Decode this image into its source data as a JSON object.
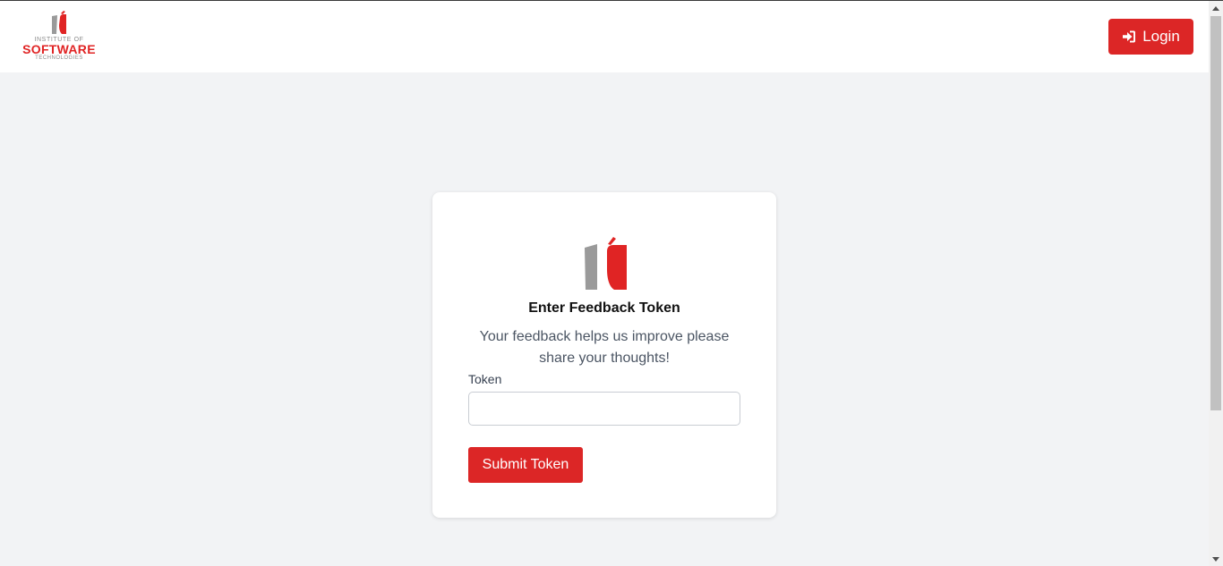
{
  "header": {
    "logo": {
      "line1": "INSTITUTE OF",
      "line2": "SOFTWARE",
      "line3": "TECHNOLOGIES",
      "icon": "ist-logo-mark"
    },
    "login_label": "Login",
    "login_icon": "sign-in-icon"
  },
  "card": {
    "title": "Enter Feedback Token",
    "subtitle": "Your feedback helps us improve please share your thoughts!",
    "token_label": "Token",
    "token_value": "",
    "token_placeholder": "",
    "submit_label": "Submit Token"
  },
  "colors": {
    "brand_red": "#dc2626",
    "logo_gray": "#9a9a9a",
    "background": "#f2f3f5"
  }
}
